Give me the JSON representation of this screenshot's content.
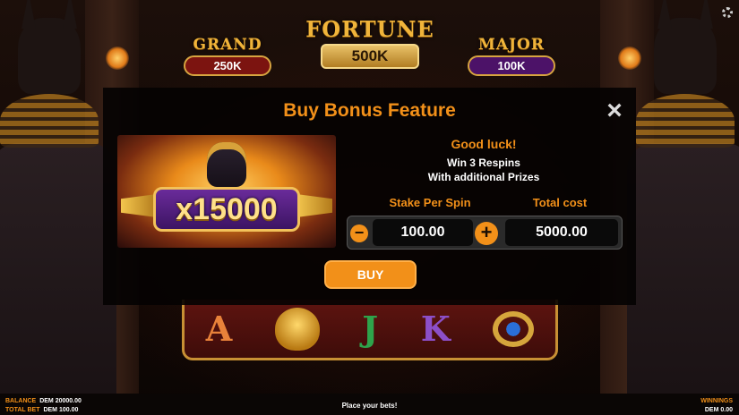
{
  "jackpots": {
    "grand": {
      "title": "GRAND",
      "value": "250K"
    },
    "fortune": {
      "title": "FORTUNE",
      "value": "500K"
    },
    "major": {
      "title": "MAJOR",
      "value": "100K"
    }
  },
  "reels": {
    "symbols": [
      "A",
      "J",
      "K"
    ]
  },
  "modal": {
    "title": "Buy Bonus Feature",
    "close_icon": "×",
    "image_multiplier": "x15000",
    "good_luck": "Good luck!",
    "line1": "Win 3 Respins",
    "line2": "With additional Prizes",
    "stake_label": "Stake Per Spin",
    "total_label": "Total cost",
    "stake_value": "100.00",
    "total_value": "5000.00",
    "minus_symbol": "−",
    "plus_symbol": "+",
    "buy_label": "BUY"
  },
  "footer": {
    "balance_label": "BALANCE",
    "balance_value": "DEM 20000.00",
    "total_bet_label": "TOTAL BET",
    "total_bet_value": "DEM 100.00",
    "status": "Place your bets!",
    "winnings_label": "WINNINGS",
    "winnings_value": "DEM 0.00"
  },
  "colors": {
    "accent": "#f29019",
    "gold": "#f0b43a"
  }
}
